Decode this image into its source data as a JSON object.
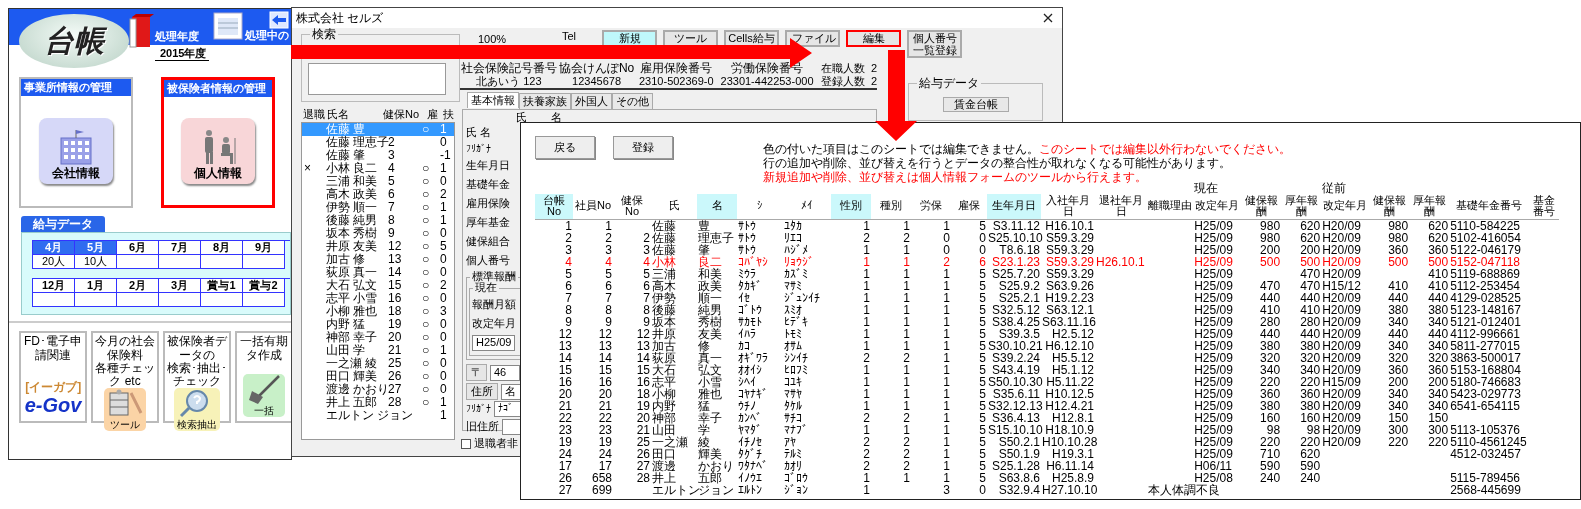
{
  "main_window": {
    "logo": "台帳",
    "fiscal_year_label": "処理年度",
    "fiscal_year": "2015年度",
    "current_label": "処理中の",
    "panels": [
      {
        "title": "事業所情報の管理",
        "button": "会社情報",
        "kind": "company",
        "highlighted": false
      },
      {
        "title": "被保険者情報の管理",
        "button": "個人情報",
        "kind": "person",
        "highlighted": true
      }
    ],
    "salary": {
      "title": "給与データ",
      "rows": [
        [
          {
            "label": "4月",
            "count": "20人",
            "has_data": true
          },
          {
            "label": "5月",
            "count": "10人",
            "has_data": true
          },
          {
            "label": "6月",
            "has_data": false
          },
          {
            "label": "7月",
            "has_data": false
          },
          {
            "label": "8月",
            "has_data": false
          },
          {
            "label": "9月",
            "has_data": false
          }
        ],
        [
          {
            "label": "12月",
            "has_data": false
          },
          {
            "label": "1月",
            "has_data": false
          },
          {
            "label": "2月",
            "has_data": false
          },
          {
            "label": "3月",
            "has_data": false
          },
          {
            "label": "賞与1",
            "has_data": false
          },
          {
            "label": "賞与2",
            "has_data": false
          }
        ]
      ]
    },
    "tools": [
      {
        "caption": [
          "FD･電子申請関連"
        ],
        "kind": "egov",
        "button": "e-Gov",
        "sub": "[イーガブ]"
      },
      {
        "caption": [
          "今月の社会保険料",
          "各種チェック etc"
        ],
        "kind": "tool",
        "button": "ツール"
      },
      {
        "caption": [
          "被保険者データの",
          "検索･抽出･チェック"
        ],
        "kind": "search",
        "button": "検索抽出"
      },
      {
        "caption": [
          "一括有期",
          "タ作成"
        ],
        "kind": "bulk",
        "button": "一括"
      }
    ]
  },
  "form_window": {
    "title": "株式会社 セルズ",
    "search_label": "検索",
    "zoom": "100%",
    "tel_label": "Tel",
    "toolbar": [
      {
        "label": "新規",
        "accent": true,
        "highlighted": false
      },
      {
        "label": "ツール",
        "accent": false,
        "highlighted": false
      },
      {
        "label": "Cells給与",
        "accent": false,
        "highlighted": false
      },
      {
        "label": "ファイル",
        "accent": false,
        "highlighted": false
      },
      {
        "label": "編集",
        "accent": false,
        "highlighted": true
      },
      {
        "label": "個人番号一覧登録",
        "accent": false,
        "highlighted": false
      }
    ],
    "info": [
      {
        "label": "社会保険記号番号",
        "value": "北あいう 123"
      },
      {
        "label": "協会けんぽNo",
        "value": "12345678"
      },
      {
        "label": "雇用保険番号",
        "value": "2310-502369-0"
      },
      {
        "label": "労働保険番号",
        "value": "23301-442253-000"
      }
    ],
    "counts": [
      {
        "label": "在職人数",
        "value": "2"
      },
      {
        "label": "登録人数",
        "value": "2"
      }
    ],
    "tabs": [
      {
        "label": "基本情報",
        "selected": true
      },
      {
        "label": "扶養家族",
        "selected": false
      },
      {
        "label": "外国人",
        "selected": false
      },
      {
        "label": "その他",
        "selected": false
      }
    ],
    "list_columns": [
      "退職",
      "氏名",
      "健保No",
      "雇",
      "扶"
    ],
    "list": [
      {
        "name": "佐藤 豊",
        "emp": "○",
        "dep": "1",
        "selected": true
      },
      {
        "name": "佐藤 理恵子",
        "no": "2",
        "dep": "0",
        "selected": false
      },
      {
        "name": "佐藤 肇",
        "no": "3",
        "dep": "-1",
        "selected": false
      },
      {
        "mark": "×",
        "name": "小林 良二",
        "no": "4",
        "emp": "○",
        "dep": "1",
        "selected": false
      },
      {
        "name": "三浦 和美",
        "no": "5",
        "emp": "○",
        "dep": "0",
        "selected": false
      },
      {
        "name": "高木 政美",
        "no": "6",
        "emp": "○",
        "dep": "2",
        "selected": false
      },
      {
        "name": "伊勢 順一",
        "no": "7",
        "emp": "○",
        "dep": "1",
        "selected": false
      },
      {
        "name": "後藤 純男",
        "no": "8",
        "emp": "○",
        "dep": "1",
        "selected": false
      },
      {
        "name": "坂本 秀樹",
        "no": "9",
        "emp": "○",
        "dep": "0",
        "selected": false
      },
      {
        "name": "井原 友美",
        "no": "12",
        "emp": "○",
        "dep": "5",
        "selected": false
      },
      {
        "name": "加古 修",
        "no": "13",
        "emp": "○",
        "dep": "0",
        "selected": false
      },
      {
        "name": "荻原 真一",
        "no": "14",
        "emp": "○",
        "dep": "0",
        "selected": false
      },
      {
        "name": "大石 弘文",
        "no": "15",
        "emp": "○",
        "dep": "2",
        "selected": false
      },
      {
        "name": "志平 小雪",
        "no": "16",
        "emp": "○",
        "dep": "0",
        "selected": false
      },
      {
        "name": "小柳 雅也",
        "no": "18",
        "emp": "○",
        "dep": "3",
        "selected": false
      },
      {
        "name": "内野 猛",
        "no": "19",
        "emp": "○",
        "dep": "0",
        "selected": false
      },
      {
        "name": "神部 幸子",
        "no": "20",
        "emp": "○",
        "dep": "0",
        "selected": false
      },
      {
        "name": "山田 学",
        "no": "21",
        "emp": "○",
        "dep": "1",
        "selected": false
      },
      {
        "name": "一之瀬 綾",
        "no": "25",
        "emp": "○",
        "dep": "0",
        "selected": false
      },
      {
        "name": "田口 輝美",
        "no": "26",
        "emp": "○",
        "dep": "0",
        "selected": false
      },
      {
        "name": "渡邊 かおり",
        "no": "27",
        "emp": "○",
        "dep": "0",
        "selected": false
      },
      {
        "name": "井上 五郎",
        "no": "28",
        "emp": "○",
        "dep": "1",
        "selected": false
      },
      {
        "name": "エルトン ジョン",
        "dep": "1",
        "selected": false
      }
    ],
    "form_header": [
      "氏",
      "名"
    ],
    "form": [
      {
        "kind": "label",
        "label": "氏 名"
      },
      {
        "kind": "small",
        "label": "ﾌﾘｶﾞﾅ"
      },
      {
        "kind": "label",
        "label": "生年月日"
      },
      {
        "kind": "label",
        "label": "基礎年金"
      },
      {
        "kind": "label",
        "label": "雇用保険"
      },
      {
        "kind": "label",
        "label": "厚年基金"
      },
      {
        "kind": "label",
        "label": "健保組合"
      },
      {
        "kind": "label",
        "label": "個人番号"
      },
      {
        "kind": "group",
        "label": "標準報酬",
        "sub_label": "現在",
        "items": [
          {
            "kind": "label",
            "label": "報酬月額"
          },
          {
            "kind": "label",
            "label": "改定年月"
          },
          {
            "kind": "field",
            "value": "H25/09"
          }
        ]
      },
      {
        "kind": "button",
        "label": "〒",
        "value": "46"
      },
      {
        "kind": "button",
        "label": "住所",
        "value": "名"
      },
      {
        "kind": "small",
        "label": "ﾌﾘｶﾞﾅ",
        "value": "ﾅｺﾞ"
      },
      {
        "kind": "input",
        "label": "旧住所"
      }
    ],
    "hide_retired": {
      "label": "退職者非",
      "checked": false
    },
    "salary_group": {
      "title": "給与データ",
      "button": "賃金台帳"
    }
  },
  "sheet": {
    "buttons": [
      "戻る",
      "登録"
    ],
    "notice": [
      [
        {
          "text": "色の付いた項目はこのシートでは編集できません。",
          "warning": false
        },
        {
          "text": "このシートでは編集以外行わないでください。",
          "warning": true
        }
      ],
      [
        {
          "text": "行の追加や削除、並び替えを行うとデータの整合性が取れなくなる可能性があります。",
          "warning": false
        }
      ],
      [
        {
          "text": "新規追加や削除、並び替えは個人情報フォームのツールから行えます。",
          "warning": true
        }
      ]
    ],
    "column_groups": [
      "現在",
      "従前"
    ],
    "columns": [
      {
        "label": "台帳No",
        "locked": true
      },
      {
        "label": "社員No",
        "locked": false
      },
      {
        "label": "健保No",
        "locked": false
      },
      {
        "label": "氏",
        "locked": false
      },
      {
        "label": "名",
        "locked": true
      },
      {
        "label": "ｼ",
        "locked": false
      },
      {
        "label": "ﾒｲ",
        "locked": false
      },
      {
        "label": "性別",
        "locked": true
      },
      {
        "label": "種別",
        "locked": false
      },
      {
        "label": "労保",
        "locked": false
      },
      {
        "label": "雇保",
        "locked": false
      },
      {
        "label": "生年月日",
        "locked": true
      },
      {
        "label": "入社年月日",
        "locked": false
      },
      {
        "label": "退社年月日",
        "locked": false
      },
      {
        "label": "離職理由",
        "locked": false
      },
      {
        "label": "改定年月",
        "locked": false
      },
      {
        "label": "健保報酬",
        "locked": false
      },
      {
        "label": "厚年報酬",
        "locked": false
      },
      {
        "label": "改定年月",
        "locked": false
      },
      {
        "label": "健保報酬",
        "locked": false
      },
      {
        "label": "厚年報酬",
        "locked": false
      },
      {
        "label": "基礎年金番号",
        "locked": false
      },
      {
        "label": "基金番号",
        "locked": false
      }
    ],
    "rows": [
      {
        "retired": false,
        "cells": [
          "1",
          "1",
          "",
          "佐藤",
          "豊",
          "ｻﾄｳ",
          "ﾕﾀｶ",
          "1",
          "1",
          "1",
          "5",
          "S3.11.12",
          "H16.10.1",
          "",
          "",
          "H25/09",
          "980",
          "620",
          "H20/09",
          "980",
          "620",
          "5110-584225",
          ""
        ]
      },
      {
        "retired": false,
        "cells": [
          "2",
          "2",
          "2",
          "佐藤",
          "理恵子",
          "ｻﾄｳ",
          "ﾘｴｺ",
          "2",
          "2",
          "0",
          "0",
          "S25.10.10",
          "S59.3.29",
          "",
          "",
          "H25/09",
          "980",
          "620",
          "H20/09",
          "980",
          "620",
          "5102-416054",
          ""
        ]
      },
      {
        "retired": false,
        "cells": [
          "3",
          "3",
          "3",
          "佐藤",
          "肇",
          "ｻﾄｳ",
          "ﾊｼﾞﾒ",
          "1",
          "1",
          "0",
          "0",
          "T8.6.18",
          "S59.3.29",
          "",
          "",
          "H25/09",
          "200",
          "200",
          "H20/09",
          "360",
          "360",
          "5122-046179",
          ""
        ]
      },
      {
        "retired": true,
        "cells": [
          "4",
          "4",
          "4",
          "小林",
          "良二",
          "ｺﾊﾞﾔｼ",
          "ﾘｮｳｼﾞ",
          "1",
          "1",
          "2",
          "6",
          "S23.1.23",
          "S59.3.29",
          "H26.10.1",
          "",
          "H25/09",
          "500",
          "500",
          "H20/09",
          "500",
          "500",
          "5152-047118",
          ""
        ]
      },
      {
        "retired": false,
        "cells": [
          "5",
          "5",
          "5",
          "三浦",
          "和美",
          "ﾐｳﾗ",
          "ｶｽﾞﾐ",
          "1",
          "1",
          "1",
          "5",
          "S25.7.20",
          "S59.3.29",
          "",
          "",
          "H25/09",
          "",
          "470",
          "H20/09",
          "",
          "410",
          "5119-688869",
          ""
        ]
      },
      {
        "retired": false,
        "cells": [
          "6",
          "6",
          "6",
          "高木",
          "政美",
          "ﾀｶｷﾞ",
          "ﾏｻﾐ",
          "1",
          "1",
          "1",
          "5",
          "S25.9.2",
          "S63.9.26",
          "",
          "",
          "H25/09",
          "470",
          "470",
          "H15/12",
          "410",
          "410",
          "5112-253454",
          ""
        ]
      },
      {
        "retired": false,
        "cells": [
          "7",
          "7",
          "7",
          "伊勢",
          "順一",
          "ｲｾ",
          "ｼﾞｭﾝｲﾁ",
          "1",
          "1",
          "1",
          "5",
          "S25.2.1",
          "H19.2.23",
          "",
          "",
          "H25/09",
          "440",
          "440",
          "H20/09",
          "440",
          "440",
          "4129-028525",
          ""
        ]
      },
      {
        "retired": false,
        "cells": [
          "8",
          "8",
          "8",
          "後藤",
          "純男",
          "ｺﾞﾄｳ",
          "ｽﾐｵ",
          "1",
          "1",
          "1",
          "5",
          "S32.5.12",
          "S63.12.1",
          "",
          "",
          "H25/09",
          "410",
          "410",
          "H20/09",
          "380",
          "380",
          "5123-148167",
          ""
        ]
      },
      {
        "retired": false,
        "cells": [
          "9",
          "9",
          "9",
          "坂本",
          "秀樹",
          "ｻｶﾓﾄ",
          "ﾋﾃﾞｷ",
          "1",
          "1",
          "1",
          "5",
          "S38.4.25",
          "S63.11.16",
          "",
          "",
          "H25/09",
          "280",
          "280",
          "H20/09",
          "340",
          "340",
          "5121-012401",
          ""
        ]
      },
      {
        "retired": false,
        "cells": [
          "12",
          "12",
          "12",
          "井原",
          "友美",
          "ｲﾊﾗ",
          "ﾄﾓﾐ",
          "1",
          "1",
          "1",
          "5",
          "S39.3.5",
          "H2.5.12",
          "",
          "",
          "H25/09",
          "440",
          "440",
          "H20/09",
          "440",
          "440",
          "4112-996661",
          ""
        ]
      },
      {
        "retired": false,
        "cells": [
          "13",
          "13",
          "13",
          "加古",
          "修",
          "ｶｺ",
          "ｵｻﾑ",
          "1",
          "1",
          "1",
          "5",
          "S30.10.21",
          "H6.12.10",
          "",
          "",
          "H25/09",
          "380",
          "380",
          "H20/09",
          "340",
          "340",
          "5811-277015",
          ""
        ]
      },
      {
        "retired": false,
        "cells": [
          "14",
          "14",
          "14",
          "荻原",
          "真一",
          "ｵｷﾞﾜﾗ",
          "ｼﾝｲﾁ",
          "2",
          "2",
          "1",
          "5",
          "S39.2.24",
          "H5.5.12",
          "",
          "",
          "H25/09",
          "320",
          "320",
          "H20/09",
          "320",
          "320",
          "3863-500017",
          ""
        ]
      },
      {
        "retired": false,
        "cells": [
          "15",
          "15",
          "15",
          "大石",
          "弘文",
          "ｵｵｲｼ",
          "ﾋﾛﾌﾐ",
          "1",
          "1",
          "1",
          "5",
          "S43.4.19",
          "H5.1.12",
          "",
          "",
          "H25/09",
          "340",
          "340",
          "H20/09",
          "360",
          "360",
          "5153-168804",
          ""
        ]
      },
      {
        "retired": false,
        "cells": [
          "16",
          "16",
          "16",
          "志平",
          "小雪",
          "ｼﾍｲ",
          "ｺﾕｷ",
          "1",
          "1",
          "1",
          "5",
          "S50.10.30",
          "H5.11.22",
          "",
          "",
          "H25/09",
          "220",
          "220",
          "H15/09",
          "200",
          "200",
          "5180-746683",
          ""
        ]
      },
      {
        "retired": false,
        "cells": [
          "20",
          "20",
          "18",
          "小柳",
          "雅也",
          "ｺﾔﾅｷﾞ",
          "ﾏｻﾔ",
          "1",
          "1",
          "1",
          "5",
          "S35.6.11",
          "H10.12.5",
          "",
          "",
          "H25/09",
          "360",
          "360",
          "H20/09",
          "340",
          "340",
          "5423-029773",
          ""
        ]
      },
      {
        "retired": false,
        "cells": [
          "21",
          "21",
          "19",
          "内野",
          "猛",
          "ｳﾁﾉ",
          "ﾀｹﾙ",
          "1",
          "1",
          "1",
          "5",
          "S32.12.13",
          "H12.4.21",
          "",
          "",
          "H25/09",
          "380",
          "380",
          "H20/09",
          "340",
          "340",
          "6541-654115",
          ""
        ]
      },
      {
        "retired": false,
        "cells": [
          "22",
          "22",
          "20",
          "神部",
          "幸子",
          "ｶﾝﾍﾞ",
          "ｻﾁｺ",
          "2",
          "2",
          "1",
          "5",
          "S36.4.13",
          "H12.8.1",
          "",
          "",
          "H25/09",
          "160",
          "160",
          "H20/09",
          "150",
          "150",
          "",
          ""
        ]
      },
      {
        "retired": false,
        "cells": [
          "23",
          "23",
          "21",
          "山田",
          "学",
          "ﾔﾏﾀﾞ",
          "ﾏﾅﾌﾞ",
          "1",
          "1",
          "1",
          "5",
          "S15.10.10",
          "H18.10.9",
          "",
          "",
          "H25/09",
          "98",
          "98",
          "H20/09",
          "300",
          "300",
          "5113-105376",
          ""
        ]
      },
      {
        "retired": false,
        "cells": [
          "19",
          "19",
          "25",
          "一之瀬",
          "綾",
          "ｲﾁﾉｾ",
          "ｱﾔ",
          "2",
          "2",
          "1",
          "5",
          "S50.2.1",
          "H10.10.28",
          "",
          "",
          "H25/09",
          "220",
          "220",
          "H20/09",
          "220",
          "220",
          "5110-4561245",
          ""
        ]
      },
      {
        "retired": false,
        "cells": [
          "24",
          "24",
          "26",
          "田口",
          "輝美",
          "ﾀｸﾞﾁ",
          "ﾃﾙﾐ",
          "2",
          "2",
          "1",
          "5",
          "S50.1.9",
          "H19.3.1",
          "",
          "",
          "H25/09",
          "710",
          "620",
          "",
          "",
          "",
          "4512-032457",
          ""
        ]
      },
      {
        "retired": false,
        "cells": [
          "17",
          "17",
          "27",
          "渡邊",
          "かおり",
          "ﾜﾀﾅﾍﾞ",
          "ｶｵﾘ",
          "2",
          "2",
          "1",
          "5",
          "S25.1.28",
          "H6.11.14",
          "",
          "",
          "H06/11",
          "590",
          "590",
          "",
          "",
          "",
          "",
          ""
        ]
      },
      {
        "retired": false,
        "cells": [
          "26",
          "658",
          "28",
          "井上",
          "五郎",
          "ｲﾉｳｴ",
          "ｺﾞﾛｳ",
          "1",
          "1",
          "1",
          "5",
          "S63.8.6",
          "H25.8.9",
          "",
          "",
          "H25/08",
          "240",
          "240",
          "",
          "",
          "",
          "5115-789456",
          ""
        ]
      },
      {
        "retired": false,
        "cells": [
          "27",
          "699",
          "",
          "エルトン",
          "ジョン",
          "ｴﾙﾄﾝ",
          "ｼﾞｮﾝ",
          "1",
          "",
          "3",
          "0",
          "S32.9.4",
          "H27.10.10",
          "",
          "本人体調不良",
          "",
          "",
          "",
          "",
          "",
          "",
          "2568-445699",
          ""
        ]
      }
    ]
  }
}
